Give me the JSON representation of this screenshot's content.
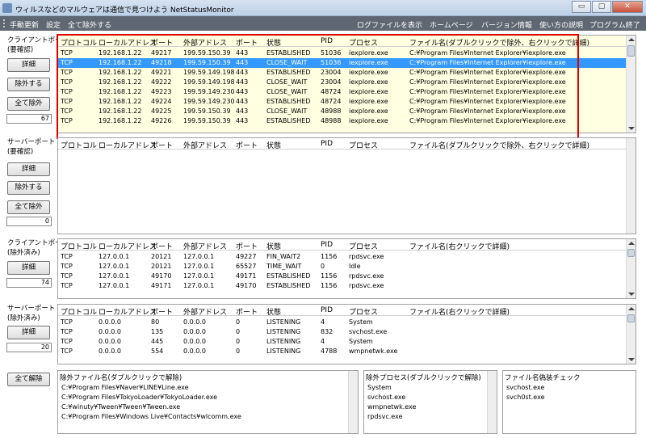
{
  "window": {
    "title": "ウィルスなどのマルウェアは通信で見つけよう NetStatusMonitor",
    "min": "▭",
    "max": "▢",
    "close": "✕"
  },
  "menu": {
    "manual_update": "手動更新",
    "settings": "設定",
    "exclude_all": "全て除外する",
    "show_log": "ログファイルを表示",
    "homepage": "ホームページ",
    "version": "バージョン情報",
    "howto": "使い方の説明",
    "exit": "プログラム終了"
  },
  "headers": {
    "protocol": "プロトコル",
    "local": "ローカルアドレス",
    "port": "ポート",
    "remote": "外部アドレス",
    "rport": "ポート",
    "state": "状態",
    "pid": "PID",
    "process": "プロセス",
    "file_dbl": "ファイル名(ダブルクリックで除外、右クリックで詳細)",
    "file_right": "ファイル名(右クリックで詳細)"
  },
  "sections": {
    "client_check": {
      "label": "クライアントポート\n(要確認)",
      "detail": "詳細",
      "exclude": "除外する",
      "exclude_all": "全て除外",
      "count": "67",
      "rows": [
        [
          "TCP",
          "192.168.1.22",
          "49217",
          "199.59.150.39",
          "443",
          "ESTABLISHED",
          "51036",
          "iexplore.exe",
          "C:¥Program Files¥Internet Explorer¥iexplore.exe"
        ],
        [
          "TCP",
          "192.168.1.22",
          "49218",
          "199.59.150.39",
          "443",
          "CLOSE_WAIT",
          "51036",
          "iexplore.exe",
          "C:¥Program Files¥Internet Explorer¥iexplore.exe"
        ],
        [
          "TCP",
          "192.168.1.22",
          "49221",
          "199.59.149.198",
          "443",
          "ESTABLISHED",
          "23004",
          "iexplore.exe",
          "C:¥Program Files¥Internet Explorer¥iexplore.exe"
        ],
        [
          "TCP",
          "192.168.1.22",
          "49222",
          "199.59.149.198",
          "443",
          "CLOSE_WAIT",
          "23004",
          "iexplore.exe",
          "C:¥Program Files¥Internet Explorer¥iexplore.exe"
        ],
        [
          "TCP",
          "192.168.1.22",
          "49223",
          "199.59.149.230",
          "443",
          "CLOSE_WAIT",
          "48724",
          "iexplore.exe",
          "C:¥Program Files¥Internet Explorer¥iexplore.exe"
        ],
        [
          "TCP",
          "192.168.1.22",
          "49224",
          "199.59.149.230",
          "443",
          "ESTABLISHED",
          "48724",
          "iexplore.exe",
          "C:¥Program Files¥Internet Explorer¥iexplore.exe"
        ],
        [
          "TCP",
          "192.168.1.22",
          "49225",
          "199.59.150.39",
          "443",
          "CLOSE_WAIT",
          "48988",
          "iexplore.exe",
          "C:¥Program Files¥Internet Explorer¥iexplore.exe"
        ],
        [
          "TCP",
          "192.168.1.22",
          "49226",
          "199.59.150.39",
          "443",
          "ESTABLISHED",
          "48988",
          "iexplore.exe",
          "C:¥Program Files¥Internet Explorer¥iexplore.exe"
        ]
      ]
    },
    "server_check": {
      "label": "サーバーポート\n(要確認)",
      "detail": "詳細",
      "exclude": "除外する",
      "exclude_all": "全て除外",
      "count": "0"
    },
    "client_excluded": {
      "label": "クライアントポート\n(除外済み)",
      "detail": "詳細",
      "count": "74",
      "rows": [
        [
          "TCP",
          "127.0.0.1",
          "20121",
          "127.0.0.1",
          "49227",
          "FIN_WAIT2",
          "1156",
          "rpdsvc.exe"
        ],
        [
          "TCP",
          "127.0.0.1",
          "20121",
          "127.0.0.1",
          "65527",
          "TIME_WAIT",
          "0",
          "Idle"
        ],
        [
          "TCP",
          "127.0.0.1",
          "49170",
          "127.0.0.1",
          "49171",
          "ESTABLISHED",
          "1156",
          "rpdsvc.exe"
        ],
        [
          "TCP",
          "127.0.0.1",
          "49171",
          "127.0.0.1",
          "49170",
          "ESTABLISHED",
          "1156",
          "rpdsvc.exe"
        ]
      ]
    },
    "server_excluded": {
      "label": "サーバーポート\n(除外済み)",
      "detail": "詳細",
      "count": "20",
      "rows": [
        [
          "TCP",
          "0.0.0.0",
          "80",
          "0.0.0.0",
          "0",
          "LISTENING",
          "4",
          "System"
        ],
        [
          "TCP",
          "0.0.0.0",
          "135",
          "0.0.0.0",
          "0",
          "LISTENING",
          "832",
          "svchost.exe"
        ],
        [
          "TCP",
          "0.0.0.0",
          "445",
          "0.0.0.0",
          "0",
          "LISTENING",
          "4",
          "System"
        ],
        [
          "TCP",
          "0.0.0.0",
          "554",
          "0.0.0.0",
          "0",
          "LISTENING",
          "4788",
          "wmpnetwk.exe"
        ]
      ]
    }
  },
  "bottom": {
    "release_all": "全て解除",
    "excluded_files": {
      "header": "除外ファイル名(ダブルクリックで解除)",
      "items": [
        "C:¥Program Files¥Naver¥LINE¥Line.exe",
        "C:¥Program Files¥TokyoLoader¥TokyoLoader.exe",
        "C:¥winuty¥Tween¥Tween¥Tween.exe",
        "C:¥Program Files¥Windows Live¥Contacts¥wlcomm.exe"
      ]
    },
    "excluded_procs": {
      "header": "除外プロセス(ダブルクリックで解除)",
      "items": [
        "System",
        "svchost.exe",
        "wmpnetwk.exe",
        "rpdsvc.exe"
      ]
    },
    "fake_check": {
      "header": "ファイル名偽装チェック",
      "items": [
        "svchost.exe",
        "svch0st.exe"
      ]
    }
  }
}
